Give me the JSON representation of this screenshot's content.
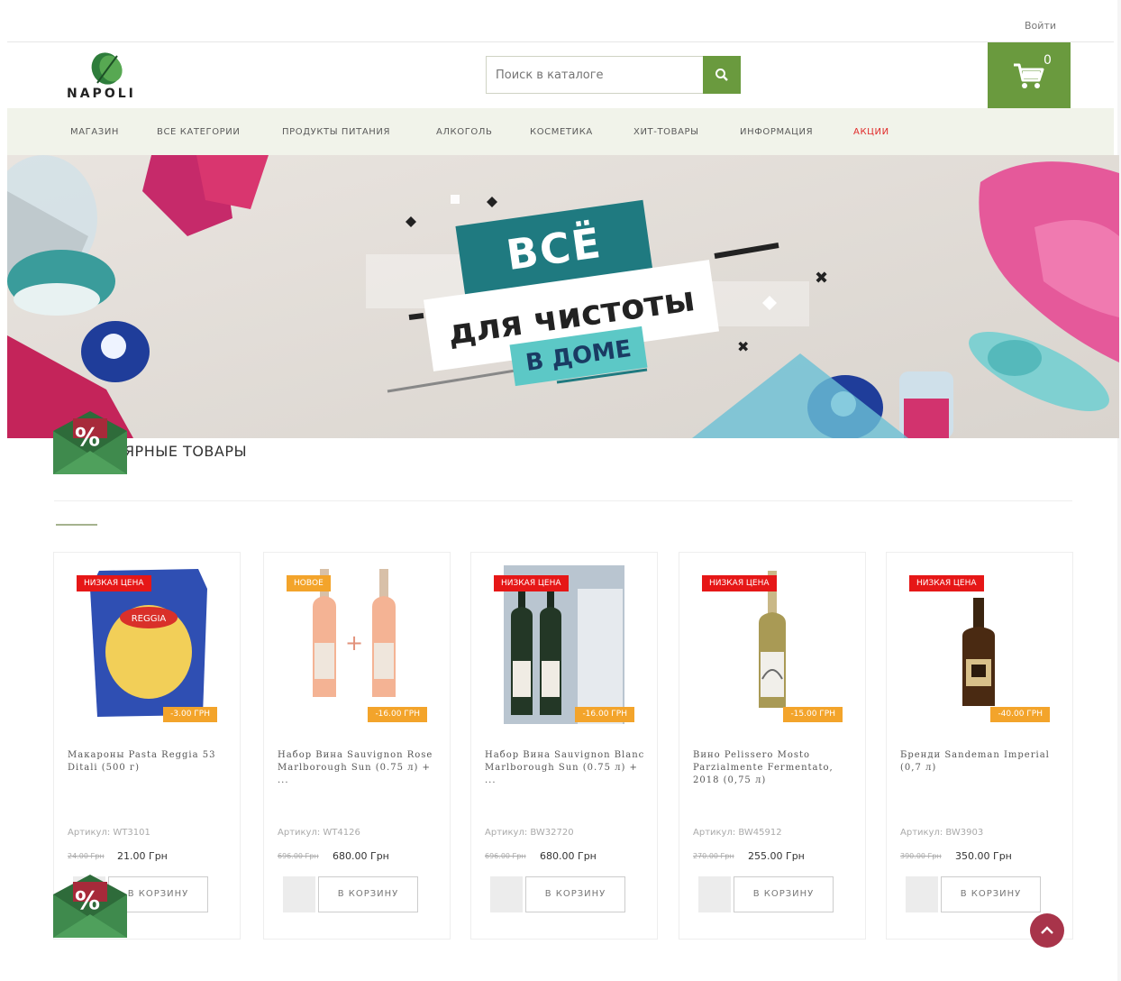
{
  "header": {
    "login_label": "Войти",
    "logo_text": "NAPOLI",
    "search_placeholder": "Поиск в каталоге",
    "cart_count": "0"
  },
  "nav": [
    {
      "label": "МАГАЗИН"
    },
    {
      "label": "ВСЕ КАТЕГОРИИ"
    },
    {
      "label": "ПРОДУКТЫ ПИТАНИЯ"
    },
    {
      "label": "АЛКОГОЛЬ"
    },
    {
      "label": "КОСМЕТИКА"
    },
    {
      "label": "ХИТ-ТОВАРЫ"
    },
    {
      "label": "ИНФОРМАЦИЯ"
    },
    {
      "label": "АКЦИИ"
    }
  ],
  "banner": {
    "line1": "ВСЁ",
    "line2": "для чистоты",
    "line3": "в доме"
  },
  "section_title": "ПОПУЛЯРНЫЕ ТОВАРЫ",
  "promo_badge_symbol": "%",
  "products": [
    {
      "badge": "НИЗКАЯ ЦЕНА",
      "discount": "-3.00 ГРН",
      "name": "Макароны Pasta Reggia 53 Ditali (500 г)",
      "sku": "Артикул: WT3101",
      "price_old": "24.00 Грн",
      "price_new": "21.00 Грн",
      "button": "В КОРЗИНУ"
    },
    {
      "badge": "НОВОЕ",
      "discount": "-16.00 ГРН",
      "name": "Набор Вина Sauvignon Rose Marlborough Sun (0.75 л) + ...",
      "sku": "Артикул: WT4126",
      "price_old": "696.00 Грн",
      "price_new": "680.00 Грн",
      "button": "В КОРЗИНУ"
    },
    {
      "badge": "НИЗКАЯ ЦЕНА",
      "discount": "-16.00 ГРН",
      "name": "Набор Вина Sauvignon Blanc Marlborough Sun (0.75 л) + ...",
      "sku": "Артикул: BW32720",
      "price_old": "696.00 Грн",
      "price_new": "680.00 Грн",
      "button": "В КОРЗИНУ"
    },
    {
      "badge": "НИЗКАЯ ЦЕНА",
      "discount": "-15.00 ГРН",
      "name": "Вино Pelissero Mosto Parzialmente Fermentato, 2018 (0,75 л)",
      "sku": "Артикул: BW45912",
      "price_old": "270.00 Грн",
      "price_new": "255.00 Грн",
      "button": "В КОРЗИНУ"
    },
    {
      "badge": "НИЗКАЯ ЦЕНА",
      "discount": "-40.00 ГРН",
      "name": "Бренди Sandeman Imperial (0,7 л)",
      "sku": "Артикул: BW3903",
      "price_old": "390.00 Грн",
      "price_new": "350.00 Грн",
      "button": "В КОРЗИНУ"
    }
  ],
  "colors": {
    "brand_green": "#6a9a3e",
    "nav_bg": "#f1f3ea",
    "label_red": "#e61717",
    "label_orange": "#f3a42b",
    "promo_link": "#e12a2a",
    "scrolltop": "#a8344a",
    "banner_teal": "#1f7a80"
  }
}
